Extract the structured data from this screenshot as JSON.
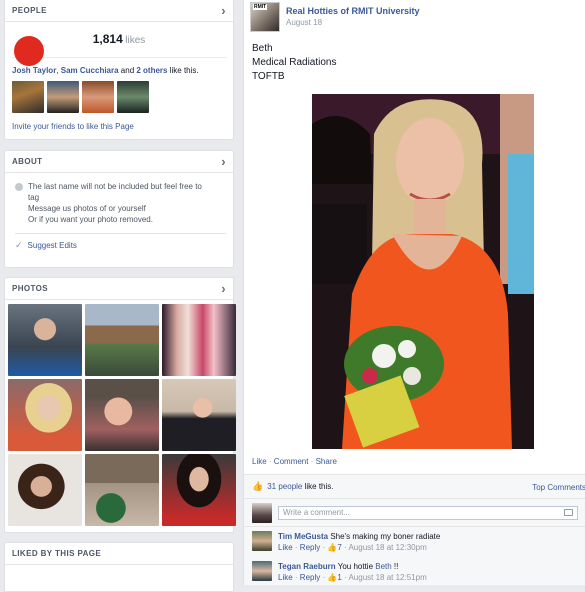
{
  "sidebar": {
    "people": {
      "header": "PEOPLE",
      "likes_count": "1,814",
      "likes_word": "likes",
      "friend_1": "Josh Taylor",
      "sep_1": ", ",
      "friend_2": "Sam Cucchiara",
      "sep_2": " and ",
      "others": "2 others",
      "like_this": " like this.",
      "invite": "Invite your friends to like this Page"
    },
    "about": {
      "header": "ABOUT",
      "line_1": "The last name will not be included but feel free to",
      "line_2": "tag",
      "line_3": "Message us photos of or yourself",
      "line_4": "Or if you want your photo removed.",
      "suggest": "Suggest Edits"
    },
    "photos": {
      "header": "PHOTOS"
    },
    "liked_by": {
      "header": "LIKED BY THIS PAGE"
    }
  },
  "post": {
    "page_name": "Real Hotties of RMIT University",
    "avatar_text": "RMIT",
    "date": "August 18",
    "text_1": "Beth",
    "text_2": "Medical Radiations",
    "text_3": "TOFTB",
    "action_like": "Like",
    "action_comment": "Comment",
    "action_share": "Share",
    "dot": " · ",
    "likes_people": "31 people",
    "likes_suffix": " like this.",
    "top_comments": "Top Comments",
    "write_placeholder": "Write a comment...",
    "comments": [
      {
        "name": "Tim MeGusta",
        "text": "She's making my boner radiate",
        "like": "Like",
        "reply": "Reply",
        "likes": "7",
        "time": "August 18 at 12:30pm"
      },
      {
        "name": "Tegan Raeburn",
        "text_prefix": "You hottie ",
        "mention": "Beth",
        "text_suffix": " !!",
        "like": "Like",
        "reply": "Reply",
        "likes": "1",
        "time": "August 18 at 12:51pm"
      }
    ]
  },
  "colors": {
    "link": "#3b5998",
    "background": "#e9eaed",
    "post_photo_dress": "#f0561e"
  }
}
